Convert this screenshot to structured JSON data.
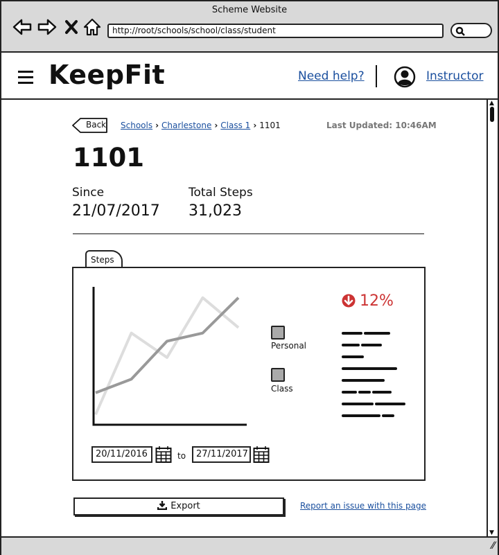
{
  "window": {
    "title": "Scheme Website",
    "url": "http://root/schools/school/class/student"
  },
  "header": {
    "logo": "KeepFit",
    "help_link": "Need help?",
    "user_link": "Instructor"
  },
  "breadcrumb": {
    "back_label": "Back",
    "items": [
      "Schools",
      "Charlestone",
      "Class 1"
    ],
    "current": "1101",
    "last_updated": "Last Updated: 10:46AM"
  },
  "student": {
    "id": "1101",
    "since_label": "Since",
    "since_value": "21/07/2017",
    "steps_label": "Total Steps",
    "steps_value": "31,023"
  },
  "panel": {
    "tab_label": "Steps",
    "change": "12%",
    "date_from": "20/11/2016",
    "to_label": "to",
    "date_to": "27/11/2017"
  },
  "chart_data": {
    "type": "line",
    "x": [
      1,
      2,
      3,
      4,
      5
    ],
    "series": [
      {
        "name": "Personal",
        "values": [
          1.1,
          1.6,
          3.0,
          3.3,
          4.6
        ]
      },
      {
        "name": "Class",
        "values": [
          0.3,
          3.3,
          2.4,
          4.6,
          3.5
        ]
      }
    ],
    "legend": [
      "Personal",
      "Class"
    ],
    "colors": {
      "Personal": "#999999",
      "Class": "#dddddd"
    },
    "ylim": [
      0,
      5
    ],
    "xlim": [
      1,
      5
    ]
  },
  "footer": {
    "export_label": "Export",
    "report_link": "Report an issue with this page"
  },
  "colors": {
    "link": "#1a4f9e",
    "alert": "#cc3333",
    "chrome": "#d9d9d9"
  }
}
